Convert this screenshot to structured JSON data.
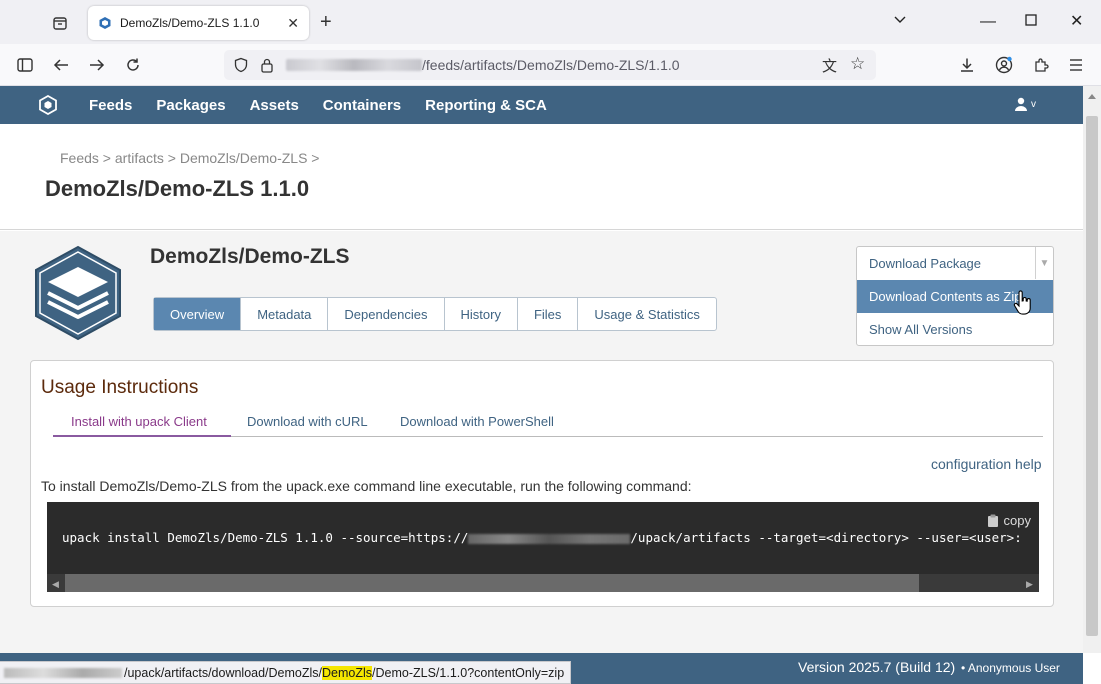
{
  "browser": {
    "tab_title": "DemoZls/Demo-ZLS 1.1.0",
    "url_path": "/feeds/artifacts/DemoZls/Demo-ZLS/1.1.0"
  },
  "nav": {
    "items": [
      "Feeds",
      "Packages",
      "Assets",
      "Containers",
      "Reporting & SCA"
    ],
    "user_caret": "v"
  },
  "breadcrumb": "Feeds > artifacts > DemoZls/Demo-ZLS >",
  "page_title": "DemoZls/Demo-ZLS 1.1.0",
  "package": {
    "name": "DemoZls/Demo-ZLS",
    "tabs": [
      "Overview",
      "Metadata",
      "Dependencies",
      "History",
      "Files",
      "Usage & Statistics"
    ],
    "active_tab": "Overview"
  },
  "download": {
    "package_label": "Download Package",
    "zip_label": "Download Contents as Zip",
    "versions_label": "Show All Versions"
  },
  "usage": {
    "title": "Usage Instructions",
    "subtabs": [
      "Install with upack Client",
      "Download with cURL",
      "Download with PowerShell"
    ],
    "config_help": "configuration help",
    "install_text": "To install DemoZls/Demo-ZLS from the upack.exe command line executable, run the following command:",
    "copy_label": "copy",
    "cmd_prefix": "upack install DemoZls/Demo-ZLS 1.1.0 --source=https://",
    "cmd_suffix": "/upack/artifacts --target=<directory> --user=<user>:"
  },
  "footer": {
    "version": "Version 2025.7 (Build 12)",
    "user": "• Anonymous User"
  },
  "status": {
    "pre": "/upack/artifacts/download/DemoZls/",
    "highlight": "DemoZls",
    "post": "/Demo-ZLS/1.1.0?contentOnly=zip"
  }
}
